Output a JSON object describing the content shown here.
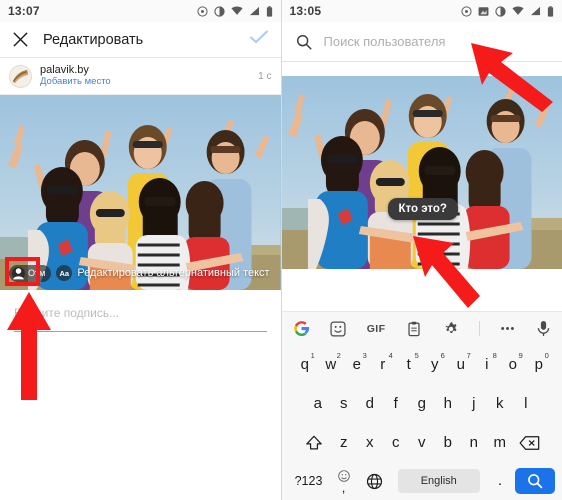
{
  "left_panel": {
    "statusbar": {
      "time": "13:07",
      "icons": [
        "alarm-icon",
        "do-not-disturb-icon",
        "wifi-icon",
        "signal-icon",
        "battery-icon"
      ]
    },
    "appbar": {
      "close_icon": "close-icon",
      "title": "Редактировать",
      "confirm_icon": "check-icon",
      "accent": "#a9cdf0"
    },
    "account": {
      "avatar_icon": "fan-avatar-icon",
      "name": "palavik.by",
      "add_location": "Добавить место",
      "add_location_color": "#4a7fd4",
      "time_ago": "1 с"
    },
    "photo_toolbar": {
      "person_icon": "person-tag-icon",
      "tag_label": "Отм",
      "aa_label": "Aa",
      "alt_text_label": "Редактировать альтернативный текст",
      "highlight_color": "#f21b1b"
    },
    "caption": {
      "placeholder": "Введите подпись...",
      "underline_color": "#7ba7e0"
    }
  },
  "right_panel": {
    "statusbar": {
      "time": "13:05",
      "icons": [
        "alarm-icon",
        "screenshot-icon",
        "do-not-disturb-icon",
        "wifi-icon",
        "signal-icon",
        "battery-icon"
      ]
    },
    "search": {
      "icon": "search-icon",
      "placeholder": "Поиск пользователя",
      "value": ""
    },
    "bubble": {
      "label": "Кто это?",
      "background": "#3a3a3a"
    },
    "keyboard": {
      "toolbar": [
        {
          "name": "google-logo-icon",
          "label": ""
        },
        {
          "name": "sticker-icon",
          "label": ""
        },
        {
          "name": "gif-icon",
          "label": "GIF"
        },
        {
          "name": "clipboard-icon",
          "label": ""
        },
        {
          "name": "settings-gear-icon",
          "label": ""
        },
        {
          "name": "overflow-dots-icon",
          "label": "•••"
        },
        {
          "name": "microphone-icon",
          "label": ""
        }
      ],
      "row1": [
        {
          "key": "q",
          "sup": "1"
        },
        {
          "key": "w",
          "sup": "2"
        },
        {
          "key": "e",
          "sup": "3"
        },
        {
          "key": "r",
          "sup": "4"
        },
        {
          "key": "t",
          "sup": "5"
        },
        {
          "key": "y",
          "sup": "6"
        },
        {
          "key": "u",
          "sup": "7"
        },
        {
          "key": "i",
          "sup": "8"
        },
        {
          "key": "o",
          "sup": "9"
        },
        {
          "key": "p",
          "sup": "0"
        }
      ],
      "row2": [
        "a",
        "s",
        "d",
        "f",
        "g",
        "h",
        "j",
        "k",
        "l"
      ],
      "row3": [
        "z",
        "x",
        "c",
        "v",
        "b",
        "n",
        "m"
      ],
      "shift_icon": "shift-icon",
      "backspace_icon": "backspace-icon",
      "numbers_key": "?123",
      "comma_key": ",",
      "emoji_icon": "emoji-icon",
      "globe_icon": "language-globe-icon",
      "space_label": "English",
      "period_key": ".",
      "search_key_icon": "search-icon",
      "search_key_color": "#1a73e8"
    }
  },
  "annotations": {
    "arrow_color": "#f51b1b",
    "arrows": [
      {
        "name": "arrow-pointing-to-tag-person-icon",
        "target": "person-tag-icon"
      },
      {
        "name": "arrow-pointing-to-search-field",
        "target": "search-input"
      },
      {
        "name": "arrow-pointing-to-who-is-this-bubble",
        "target": "who-is-this-bubble"
      }
    ]
  }
}
